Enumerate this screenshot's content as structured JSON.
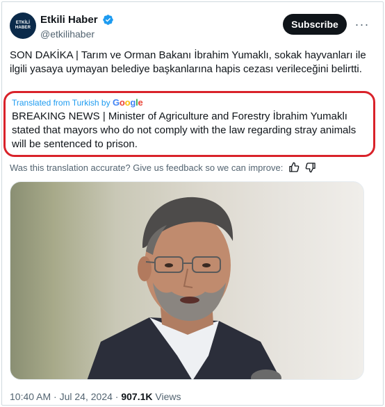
{
  "author": {
    "display_name": "Etkili Haber",
    "handle": "@etkilihaber",
    "avatar_text_line1": "ETKİLİ",
    "avatar_text_line2": "HABER",
    "verified": true
  },
  "actions": {
    "subscribe_label": "Subscribe",
    "more_icon": "more-horizontal-icon"
  },
  "tweet": {
    "text": "SON DAKİKA | Tarım ve Orman Bakanı İbrahim Yumaklı, sokak hayvanları ile ilgili yasaya uymayan belediye başkanlarına hapis cezası verileceğini belirtti."
  },
  "translation": {
    "label": "Translated from Turkish by",
    "provider": "Google",
    "text": "BREAKING NEWS | Minister of Agriculture and Forestry İbrahim Yumaklı stated that mayors who do not comply with the law regarding stray animals will be sentenced to prison.",
    "feedback_prompt": "Was this translation accurate? Give us feedback so we can improve:"
  },
  "meta": {
    "time": "10:40 AM",
    "date": "Jul 24, 2024",
    "separator": "·",
    "views_count": "907.1K",
    "views_label": "Views"
  },
  "colors": {
    "accent": "#1d9bf0",
    "highlight_border": "#d9222a",
    "text": "#0f1419",
    "secondary": "#536471"
  }
}
